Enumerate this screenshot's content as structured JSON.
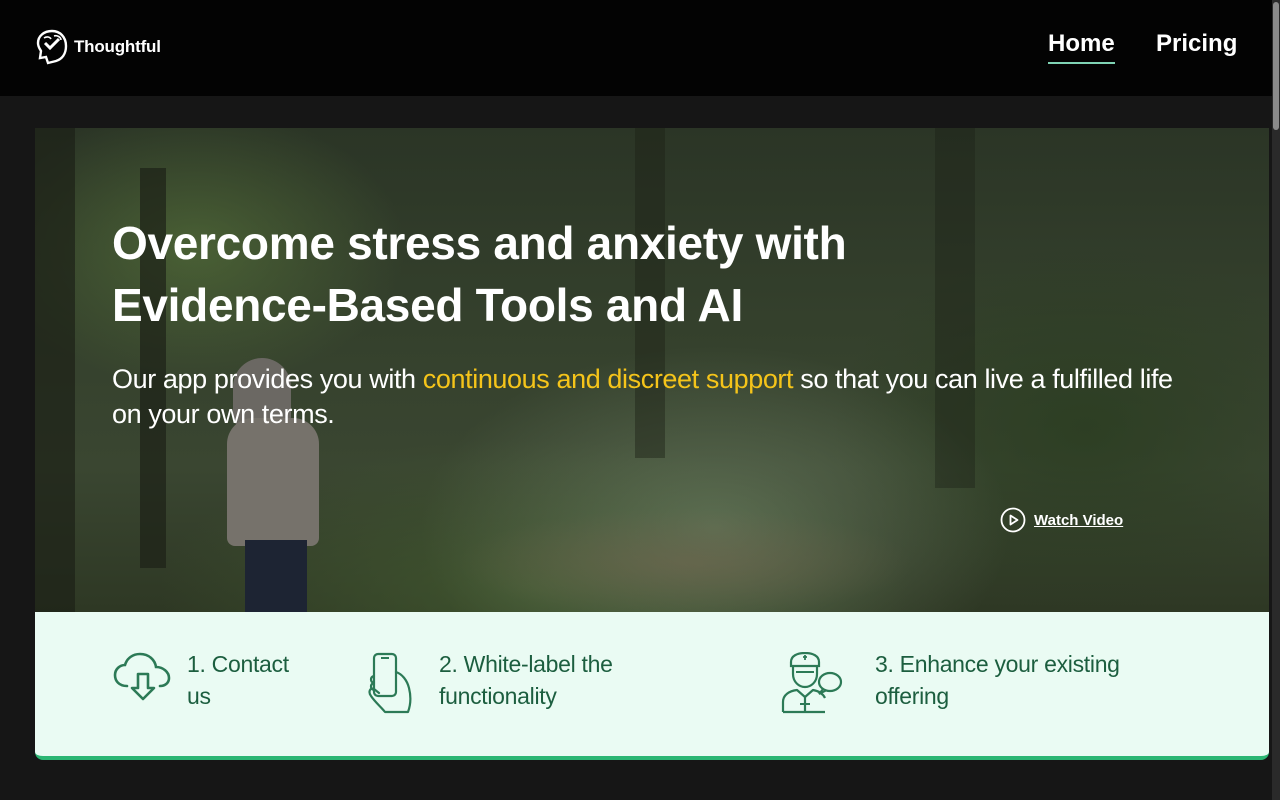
{
  "header": {
    "logo_text": "Thoughtful",
    "nav": [
      {
        "label": "Home",
        "active": true
      },
      {
        "label": "Pricing",
        "active": false
      }
    ]
  },
  "hero": {
    "headline_line1": "Overcome stress and anxiety with",
    "headline_line2": "Evidence-Based Tools and AI",
    "sub_before": "Our app provides you with ",
    "sub_highlight": "continuous and discreet support",
    "sub_after": " so that you can live a fulfilled life on your own terms.",
    "watch_video_label": "Watch Video"
  },
  "steps": [
    {
      "label": "1. Contact us",
      "icon": "cloud-download-icon"
    },
    {
      "label": "2. White-label the functionality",
      "icon": "phone-hand-icon"
    },
    {
      "label": "3. Enhance your existing offering",
      "icon": "nurse-icon"
    }
  ],
  "colors": {
    "accent": "#2bb673",
    "highlight": "#f5c41a",
    "steps_background": "#eafbf3",
    "steps_text": "#1c5e3f",
    "nav_underline": "#7fd3b4"
  }
}
